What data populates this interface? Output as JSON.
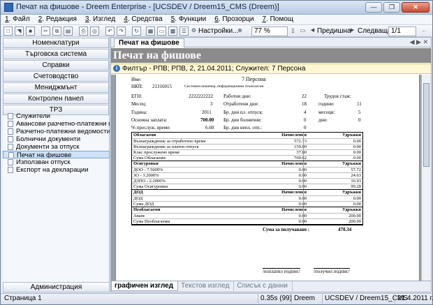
{
  "window": {
    "title": "Печат на фишове - Dreem Enterprise - [UCSDEV / Dreem15_CMS (Dreem)]"
  },
  "menu": [
    {
      "num": "1",
      "label": "Файл"
    },
    {
      "num": "2",
      "label": "Редакция"
    },
    {
      "num": "3",
      "label": "Изглед"
    },
    {
      "num": "4",
      "label": "Средства"
    },
    {
      "num": "5",
      "label": "Функции"
    },
    {
      "num": "6",
      "label": "Прозорци"
    },
    {
      "num": "7",
      "label": "Помощ"
    }
  ],
  "toolbar": {
    "settings_label": "Настройки...",
    "zoom_value": "77 %",
    "prev_label": "Предишна",
    "next_label": "Следваща",
    "page_value": "1/1"
  },
  "sidebar": {
    "nav_buttons": [
      "Номенклатури",
      "Търговска система",
      "Справки",
      "Счетоводство",
      "Мениджмънт",
      "Контролен панел",
      "ТРЗ"
    ],
    "tree_items": [
      "Служители",
      "Авансови разчетно-платежни вед...",
      "Разчетно-платежни ведомости",
      "Болнични документи",
      "Документи за отпуск",
      "Печат на фишове",
      "Използван отпуск",
      "Експорт на декларации"
    ],
    "selected_index": 5,
    "admin_label": "Администрация"
  },
  "doc": {
    "tab_label": "Печат на фишове",
    "banner_title": "Печат на фишове",
    "filter_text": "Филтър - РПВ; РПВ, 2, 21.04.2011; Служител: 7 Персона"
  },
  "report": {
    "name_label": "Име:",
    "name_value": "7 Персона",
    "nkp_label": "НКП:",
    "nkp_value": "21316015",
    "nkp_desc": "Системен инженер, информационни технологии",
    "egn_label": "ЕГН:",
    "egn_value": "2222222222",
    "month_label": "Месец:",
    "month_value": "3",
    "year_label": "Година:",
    "year_value": "2011",
    "base_label": "Основна заплата:",
    "base_value": "700.00",
    "pct_label": "% прослуж. време:",
    "pct_value": "6.60",
    "workdays_label": "Работни дни:",
    "workdays_value": "22",
    "worked_label": "Отработени дни:",
    "worked_value": "18",
    "paidleave_label": "Бр. дни пл. отпуск:",
    "paidleave_value": "4",
    "sick_label": "Бр. дни болнични:",
    "sick_value": "0",
    "unpaid_label": "Бр. дни непл. отп.:",
    "unpaid_value": "0",
    "seniority_label": "Трудов стаж:",
    "years_label": "години:",
    "years_value": "11",
    "months_label": "месеци:",
    "months_value": "5",
    "days_label": "дни:",
    "days_value": "0",
    "rows": [
      {
        "type": "hdr",
        "c1": "Облагаеми",
        "c2": "Начисления",
        "c3": "Удръжки"
      },
      {
        "type": "row",
        "c1": "Възнаграждение за отработено време",
        "c2": "572.73",
        "c3": "0.00"
      },
      {
        "type": "row",
        "c1": "Възнаграждение за платен отпуск",
        "c2": "159.09",
        "c3": "0.00"
      },
      {
        "type": "row",
        "c1": "Клас прослужено време",
        "c2": "37.80",
        "c3": "0.00"
      },
      {
        "type": "sum",
        "c1": "Сума Облагаеми",
        "c2": "769.62",
        "c3": "0.00"
      },
      {
        "type": "hdr",
        "c1": "Осигуровки",
        "c2": "Начисления",
        "c3": "Удръжки"
      },
      {
        "type": "row",
        "c1": "ДОО - 7.5000%",
        "c2": "0.00",
        "c3": "57.72"
      },
      {
        "type": "row",
        "c1": "ЗО - 3.2000%",
        "c2": "0.00",
        "c3": "24.63"
      },
      {
        "type": "row",
        "c1": "ДЗПО - 2.2000%",
        "c2": "0.00",
        "c3": "16.93"
      },
      {
        "type": "sum",
        "c1": "Сума Осигуровки",
        "c2": "0.00",
        "c3": "99.28"
      },
      {
        "type": "hdr",
        "c1": "ДОД",
        "c2": "Начисления",
        "c3": "Удръжки"
      },
      {
        "type": "row",
        "c1": "ДОД",
        "c2": "0.00",
        "c3": "0.00"
      },
      {
        "type": "sum",
        "c1": "Сума ДОД",
        "c2": "0.00",
        "c3": "0.00"
      },
      {
        "type": "hdr",
        "c1": "Необлагаеми",
        "c2": "Начисления",
        "c3": "Удръжки"
      },
      {
        "type": "row",
        "c1": "Аванс",
        "c2": "0.00",
        "c3": "200.00"
      },
      {
        "type": "sum",
        "c1": "Сума Необлагаеми",
        "c2": "0.00",
        "c3": "200.00"
      }
    ],
    "total_label": "Сума за получаване :",
    "total_value": "470.34",
    "sign_payer": "/изплатил подпис/",
    "sign_receiver": "/получил подпис/"
  },
  "bottom_tabs": [
    "графичен изглед",
    "Текстов изглед",
    "Списък с данни"
  ],
  "status": {
    "page": "Страница 1",
    "time": "0.35s (99)",
    "app": "Dreem",
    "db": "UCSDEV / Dreem15_CMS",
    "date": "21.4.2011 г."
  }
}
